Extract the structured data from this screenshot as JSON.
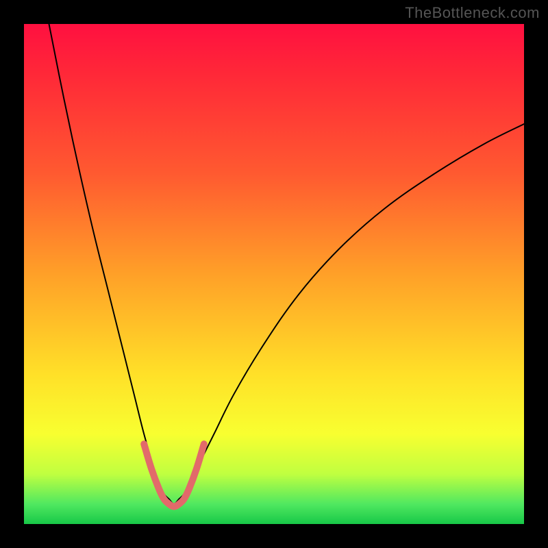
{
  "watermark": "TheBottleneck.com",
  "chart_data": {
    "type": "line",
    "title": "",
    "xlabel": "",
    "ylabel": "",
    "xlim": [
      0,
      100
    ],
    "ylim": [
      0,
      100
    ],
    "grid": false,
    "legend": false,
    "gradient_stops": [
      {
        "pos": 0,
        "color": "#ff1040"
      },
      {
        "pos": 10,
        "color": "#ff2838"
      },
      {
        "pos": 30,
        "color": "#ff5a30"
      },
      {
        "pos": 50,
        "color": "#ffa028"
      },
      {
        "pos": 70,
        "color": "#ffe028"
      },
      {
        "pos": 82,
        "color": "#f8ff30"
      },
      {
        "pos": 90,
        "color": "#c0ff40"
      },
      {
        "pos": 96,
        "color": "#50e860"
      },
      {
        "pos": 100,
        "color": "#18c848"
      }
    ],
    "series": [
      {
        "name": "bottleneck-curve",
        "stroke": "#000000",
        "stroke_width": 2,
        "x": [
          5,
          8,
          11,
          14,
          17,
          20,
          22,
          24,
          26,
          27,
          28,
          29,
          30,
          31,
          32,
          33,
          35,
          38,
          42,
          48,
          55,
          63,
          72,
          82,
          92,
          100
        ],
        "y": [
          100,
          85,
          71,
          58,
          46,
          34,
          26,
          18,
          11,
          8,
          6,
          5,
          4,
          5,
          6,
          8,
          12,
          18,
          26,
          36,
          46,
          55,
          63,
          70,
          76,
          80
        ]
      },
      {
        "name": "valley-highlight",
        "stroke": "#e26a6a",
        "stroke_width": 10,
        "x": [
          24,
          25.5,
          27,
          28,
          29,
          30,
          31,
          32,
          33,
          34.5,
          36
        ],
        "y": [
          16,
          11,
          7,
          5,
          4,
          3.5,
          4,
          5,
          7,
          11,
          16
        ]
      }
    ]
  }
}
